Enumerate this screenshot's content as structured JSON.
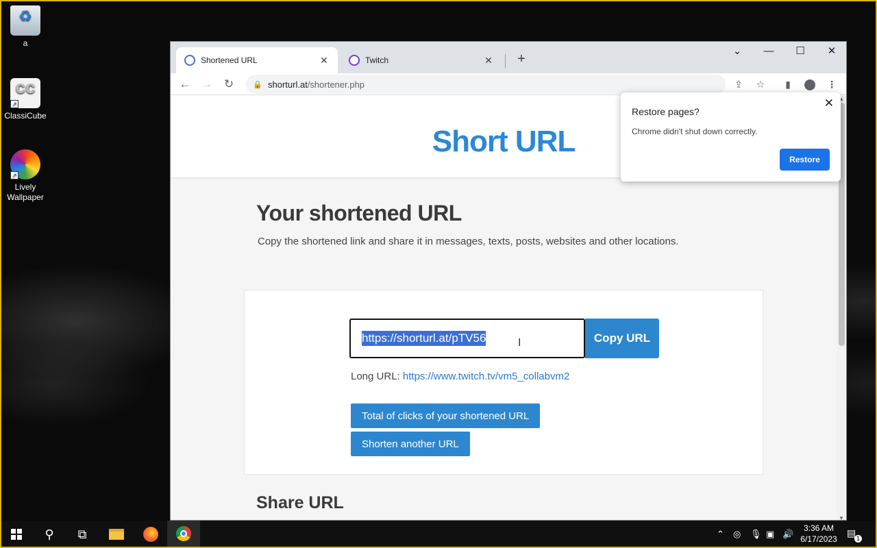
{
  "desktop": {
    "icons": [
      {
        "label": "a"
      },
      {
        "label": "ClassiCube"
      },
      {
        "label": "Lively Wallpaper"
      }
    ]
  },
  "browser": {
    "tabs": [
      {
        "title": "Shortened URL",
        "active": true
      },
      {
        "title": "Twitch",
        "active": false
      }
    ],
    "url_domain": "shorturl.at",
    "url_path": "/shortener.php"
  },
  "page": {
    "site_title": "Short URL",
    "heading": "Your shortened URL",
    "subtext": "Copy the shortened link and share it in messages, texts, posts, websites and other locations.",
    "short_url": "https://shorturl.at/pTV56",
    "copy_label": "Copy URL",
    "long_url_label": "Long URL:",
    "long_url": "https://www.twitch.tv/vm5_collabvm2",
    "total_clicks_label": "Total of clicks of your shortened URL",
    "shorten_another_label": "Shorten another URL",
    "share_heading": "Share URL"
  },
  "popup": {
    "title": "Restore pages?",
    "body": "Chrome didn't shut down correctly.",
    "restore_label": "Restore"
  },
  "taskbar": {
    "time": "3:36 AM",
    "date": "6/17/2023",
    "notification_count": "1"
  },
  "colors": {
    "accent": "#2d87cf",
    "chrome_blue": "#1a73e8"
  }
}
